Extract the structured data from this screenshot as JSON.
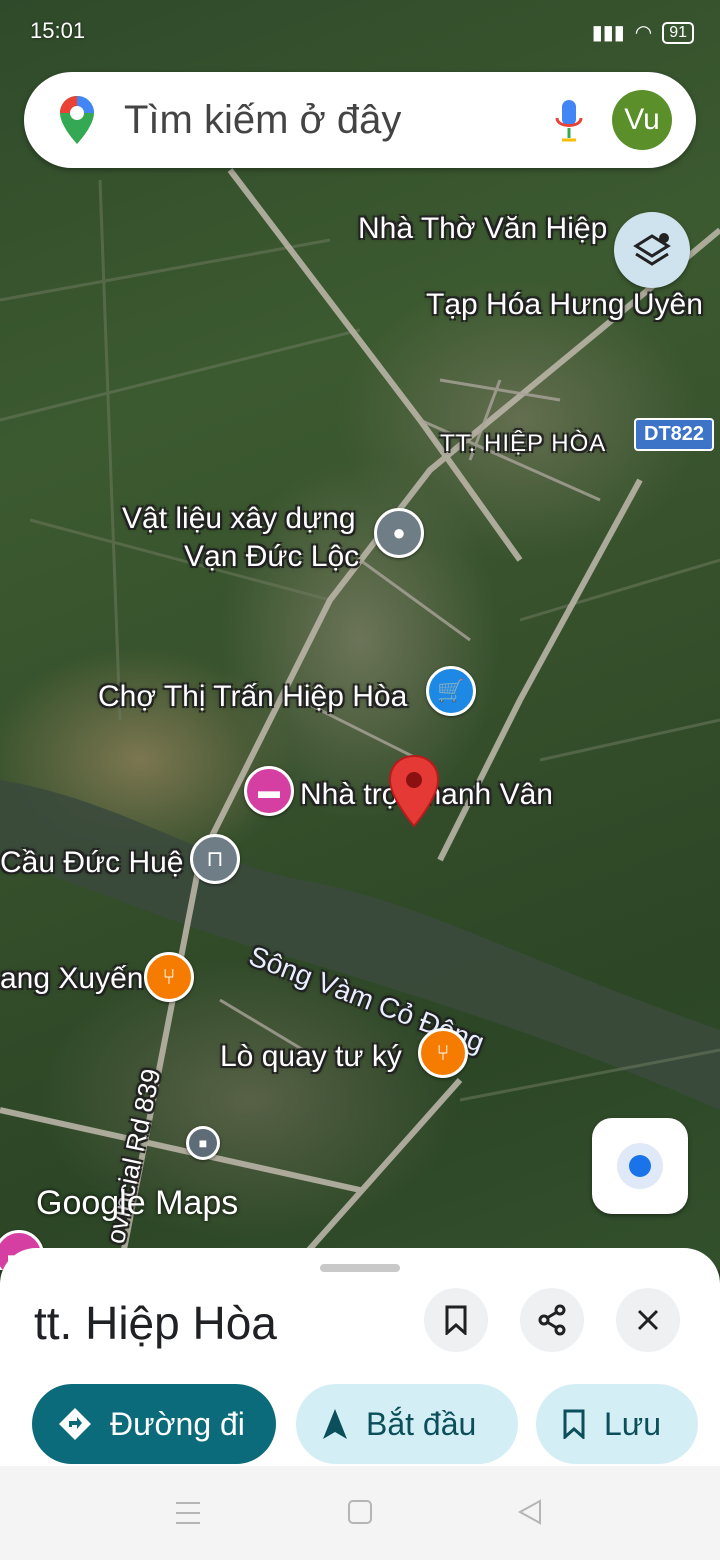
{
  "status_bar": {
    "time": "15:01",
    "battery": "91"
  },
  "search": {
    "placeholder": "Tìm kiếm ở đây",
    "avatar_initials": "Vu"
  },
  "map": {
    "labels": {
      "church": "Nhà Thờ Văn Hiệp",
      "grocery": "Tạp Hóa Hưng Uyên",
      "town": "TT. HIỆP HÒA",
      "road_badge": "DT822",
      "materials_line1": "Vật liệu xây dựng",
      "materials_line2": "Vạn Đức Lộc",
      "market": "Chợ Thị Trấn Hiệp Hòa",
      "lodging": "Nhà trọ Thanh Vân",
      "bridge": "Cầu Đức Huệ",
      "river": "Sông Vàm Cỏ Đông",
      "restaurant_left": "ang Xuyến",
      "restaurant": "Lò quay tư ký",
      "provincial_road": "ovincial Rd 839"
    },
    "attribution": "Google Maps"
  },
  "place_sheet": {
    "title": "tt. Hiệp Hòa",
    "directions_label": "Đường đi",
    "start_label": "Bắt đầu",
    "save_label": "Lưu"
  },
  "colors": {
    "accent": "#0b6b7a",
    "chip_light": "#d4eef6",
    "pin_red": "#e53935"
  }
}
